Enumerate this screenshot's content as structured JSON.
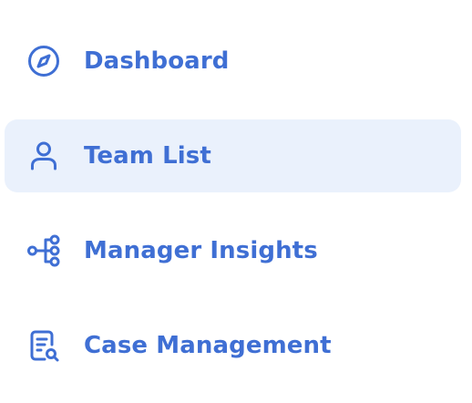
{
  "sidebar": {
    "accent_color": "#3f6fd4",
    "active_background": "#eaf1fc",
    "items": [
      {
        "label": "Dashboard",
        "icon": "compass-icon",
        "active": false
      },
      {
        "label": "Team List",
        "icon": "user-icon",
        "active": true
      },
      {
        "label": "Manager Insights",
        "icon": "hierarchy-icon",
        "active": false
      },
      {
        "label": "Case Management",
        "icon": "document-search-icon",
        "active": false
      }
    ]
  }
}
